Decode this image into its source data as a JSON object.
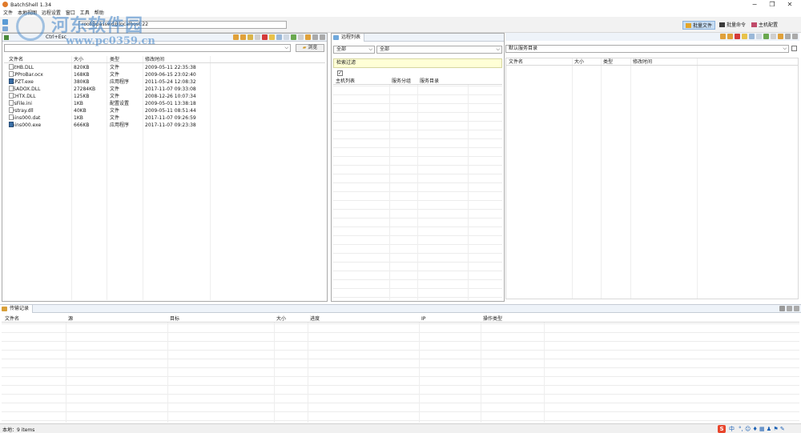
{
  "window": {
    "title": "BatchShell 1.34",
    "minimize": "−",
    "restore": "❐",
    "close": "✕"
  },
  "menu": [
    "文件",
    "本地视图",
    "远程设置",
    "窗口",
    "工具",
    "帮助"
  ],
  "toolbar": {
    "address": "root@passwd@localhost:22",
    "shortcut": "Ctrl+Esc"
  },
  "perspectives": [
    {
      "label": "批量文件",
      "active": true
    },
    {
      "label": "批量命令",
      "active": false
    },
    {
      "label": "主机配置",
      "active": false
    }
  ],
  "local": {
    "path": "",
    "browse_label": "浏览",
    "columns": [
      "文件名",
      "大小",
      "类型",
      "修改时间"
    ],
    "files": [
      {
        "name": "KstHB.DLL",
        "size": "820KB",
        "type": "文件",
        "mtime": "2009-05-11 22:35:38",
        "icon": "file"
      },
      {
        "name": "LCPProBar.ocx",
        "size": "168KB",
        "type": "文件",
        "mtime": "2009-06-15 23:02:40",
        "icon": "file"
      },
      {
        "name": "LCPZT.exe",
        "size": "380KB",
        "type": "应用程序",
        "mtime": "2011-05-24 12:08:32",
        "icon": "exe"
      },
      {
        "name": "MSADOX.DLL",
        "size": "27284KB",
        "type": "文件",
        "mtime": "2017-11-07 09:33:08",
        "icon": "file"
      },
      {
        "name": "RCHTX.DLL",
        "size": "125KB",
        "type": "文件",
        "mtime": "2008-12-26 10:07:34",
        "icon": "file"
      },
      {
        "name": "sysFile.ini",
        "size": "1KB",
        "type": "配置设置",
        "mtime": "2009-05-01 13:38:18",
        "icon": "file"
      },
      {
        "name": "Systray.dll",
        "size": "40KB",
        "type": "文件",
        "mtime": "2009-05-11 08:51:44",
        "icon": "file"
      },
      {
        "name": "unins000.dat",
        "size": "1KB",
        "type": "文件",
        "mtime": "2017-11-07 09:26:59",
        "icon": "file"
      },
      {
        "name": "unins000.exe",
        "size": "666KB",
        "type": "应用程序",
        "mtime": "2017-11-07 09:23:38",
        "icon": "exe"
      }
    ]
  },
  "remote_list": {
    "tab": "远程列表",
    "group_select": "全部",
    "host_select": "全部",
    "filter_label": "检索过滤",
    "columns": [
      "主机列表",
      "服务分组",
      "服务目录"
    ]
  },
  "remote_files": {
    "dir_select": "默认服务目录",
    "columns": [
      "文件名",
      "大小",
      "类型",
      "修改时间"
    ]
  },
  "transfer": {
    "tab": "传输记录",
    "columns": [
      "文件名",
      "源",
      "目标",
      "大小",
      "进度",
      "IP",
      "操作类型"
    ]
  },
  "status": {
    "text": "本地：9 items"
  },
  "watermark": {
    "cn": "河东软件园",
    "url": "www.pc0359.cn"
  },
  "tray": {
    "s": "S",
    "zh": "中"
  }
}
